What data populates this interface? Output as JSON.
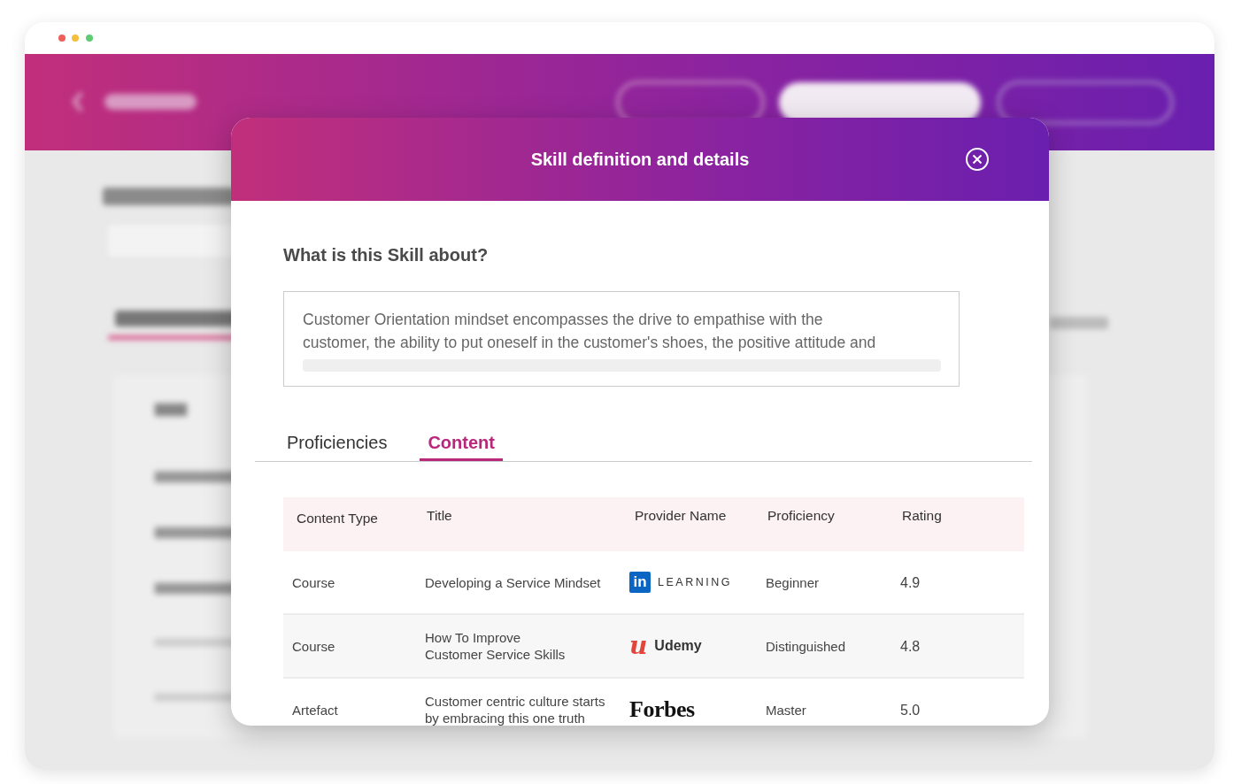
{
  "modal": {
    "title": "Skill definition and details",
    "section_title": "What is this Skill about?",
    "description_lines": [
      "Customer Orientation mindset encompasses the drive to empathise with the",
      "customer, the ability to put oneself in the customer's shoes, the positive attitude and"
    ],
    "tabs": [
      {
        "label": "Proficiencies",
        "selected": false
      },
      {
        "label": "Content",
        "selected": true
      }
    ],
    "table": {
      "columns": [
        "Content Type",
        "Title",
        "Provider Name",
        "Proficiency",
        "Rating"
      ],
      "rows": [
        {
          "content_type": "Course",
          "title_lines": [
            "Developing a Service Mindset"
          ],
          "provider": {
            "kind": "linkedin",
            "badge": "in",
            "name": "LEARNING"
          },
          "proficiency": "Beginner",
          "rating": "4.9"
        },
        {
          "content_type": "Course",
          "title_lines": [
            "How To Improve",
            "Customer Service Skills"
          ],
          "provider": {
            "kind": "udemy",
            "badge": "u",
            "name": "Udemy"
          },
          "proficiency": "Distinguished",
          "rating": "4.8"
        },
        {
          "content_type": "Artefact",
          "title_lines": [
            "Customer centric culture starts",
            "by embracing this one truth"
          ],
          "provider": {
            "kind": "forbes",
            "name": "Forbes"
          },
          "proficiency": "Master",
          "rating": "5.0"
        }
      ]
    }
  }
}
